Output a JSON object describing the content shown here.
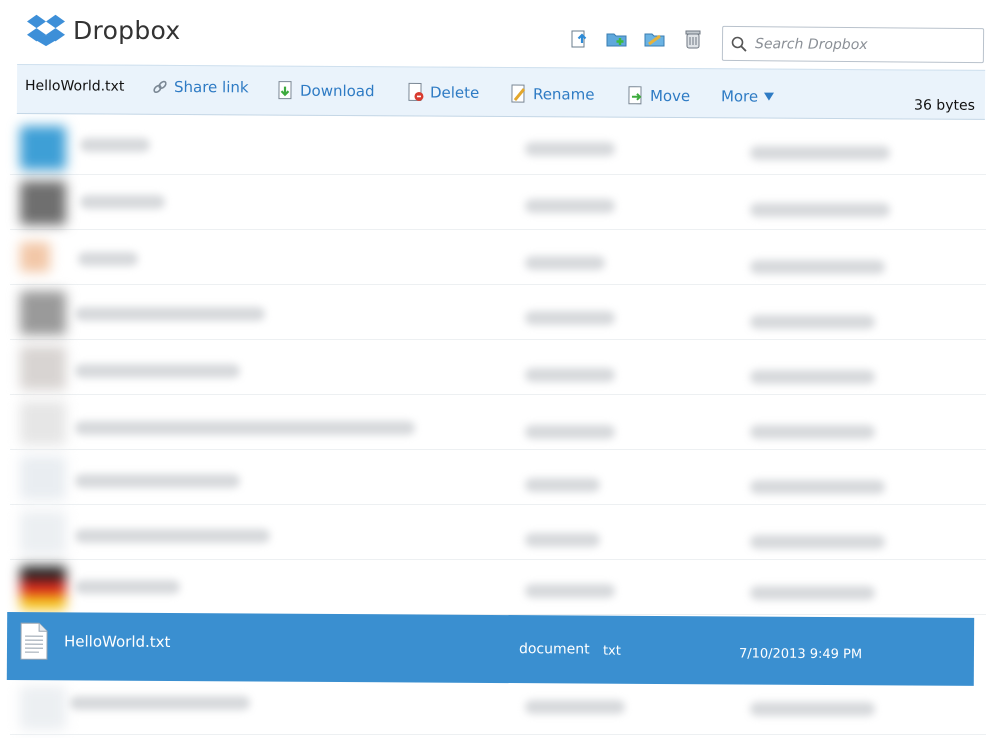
{
  "app": {
    "name": "Dropbox",
    "brand_color": "#2e7bc4",
    "selection_color": "#3a8fd0"
  },
  "header": {
    "icons": [
      {
        "name": "upload-icon"
      },
      {
        "name": "new-folder-icon"
      },
      {
        "name": "shared-folder-icon"
      },
      {
        "name": "deleted-files-icon"
      }
    ],
    "search": {
      "placeholder": "Search Dropbox",
      "value": ""
    }
  },
  "actionbar": {
    "filename": "HelloWorld.txt",
    "share_link": "Share link",
    "download": "Download",
    "delete": "Delete",
    "rename": "Rename",
    "move": "Move",
    "more": "More",
    "size": "36 bytes"
  },
  "selected_file": {
    "name": "HelloWorld.txt",
    "kind": "document",
    "ext": "txt",
    "modified": "7/10/2013 9:49 PM"
  }
}
